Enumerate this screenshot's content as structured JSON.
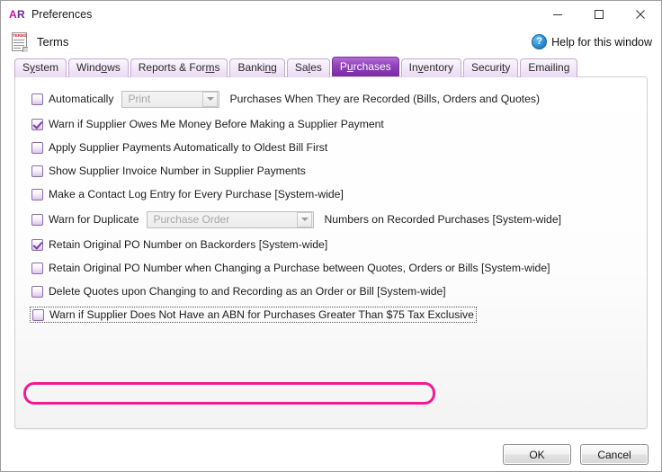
{
  "window": {
    "logo_a": "A",
    "logo_r": "R",
    "title": "Preferences",
    "minimize_label": "Minimize",
    "maximize_label": "Maximize",
    "close_label": "Close"
  },
  "header": {
    "icon_caption": "TERMS",
    "title": "Terms",
    "help_icon": "?",
    "help_text": "Help for this window"
  },
  "tabs": [
    {
      "label": "System",
      "accel_index": 1,
      "active": false
    },
    {
      "label": "Windows",
      "accel_index": 4,
      "active": false
    },
    {
      "label": "Reports & Forms",
      "accel_index": 13,
      "active": false
    },
    {
      "label": "Banking",
      "accel_index": 5,
      "active": false
    },
    {
      "label": "Sales",
      "accel_index": 2,
      "active": false
    },
    {
      "label": "Purchases",
      "accel_index": 1,
      "active": true
    },
    {
      "label": "Inventory",
      "accel_index": 2,
      "active": false
    },
    {
      "label": "Security",
      "accel_index": 6,
      "active": false
    },
    {
      "label": "Emailing",
      "accel_index": -1,
      "active": false
    }
  ],
  "options": [
    {
      "id": "automatically-print",
      "checked": false,
      "label": "Automatically",
      "dropdown": {
        "value": "Print",
        "enabled": false,
        "width": 109
      },
      "trail": "Purchases When They are Recorded (Bills, Orders and Quotes)",
      "highlighted": false
    },
    {
      "id": "warn-supplier-owes-money",
      "checked": true,
      "label": "Warn if Supplier Owes Me Money Before Making a Supplier Payment",
      "dropdown": null,
      "trail": "",
      "highlighted": false
    },
    {
      "id": "apply-payments-oldest-bill",
      "checked": false,
      "label": "Apply Supplier Payments Automatically to Oldest Bill First",
      "dropdown": null,
      "trail": "",
      "highlighted": false
    },
    {
      "id": "show-supplier-invoice-number",
      "checked": false,
      "label": "Show Supplier Invoice Number in Supplier Payments",
      "dropdown": null,
      "trail": "",
      "highlighted": false
    },
    {
      "id": "contact-log-entry",
      "checked": false,
      "label": "Make a Contact Log Entry for Every Purchase [System-wide]",
      "dropdown": null,
      "trail": "",
      "highlighted": false
    },
    {
      "id": "warn-duplicate",
      "checked": false,
      "label": "Warn for Duplicate",
      "dropdown": {
        "value": "Purchase Order",
        "enabled": false,
        "width": 186
      },
      "trail": "Numbers on Recorded Purchases [System-wide]",
      "highlighted": false
    },
    {
      "id": "retain-po-backorders",
      "checked": true,
      "label": "Retain Original PO Number on Backorders [System-wide]",
      "dropdown": null,
      "trail": "",
      "highlighted": false
    },
    {
      "id": "retain-po-changing-purchase",
      "checked": false,
      "label": "Retain Original PO Number when Changing a Purchase between Quotes, Orders or Bills [System-wide]",
      "dropdown": null,
      "trail": "",
      "highlighted": false
    },
    {
      "id": "delete-quotes-on-change",
      "checked": false,
      "label": "Delete Quotes upon Changing to and Recording as an Order or Bill [System-wide]",
      "dropdown": null,
      "trail": "",
      "highlighted": false
    },
    {
      "id": "warn-no-abn",
      "checked": false,
      "label": "Warn if Supplier Does Not Have an ABN for Purchases Greater Than $75 Tax Exclusive",
      "dropdown": null,
      "trail": "",
      "highlighted": true
    }
  ],
  "footer": {
    "ok_label": "OK",
    "cancel_label": "Cancel"
  },
  "colors": {
    "accent_purple": "#7b2ba5",
    "highlight_pink": "#f01a96",
    "logo_magenta": "#c2149c",
    "logo_purple": "#6b2a8f",
    "help_blue": "#2e8fd4"
  }
}
